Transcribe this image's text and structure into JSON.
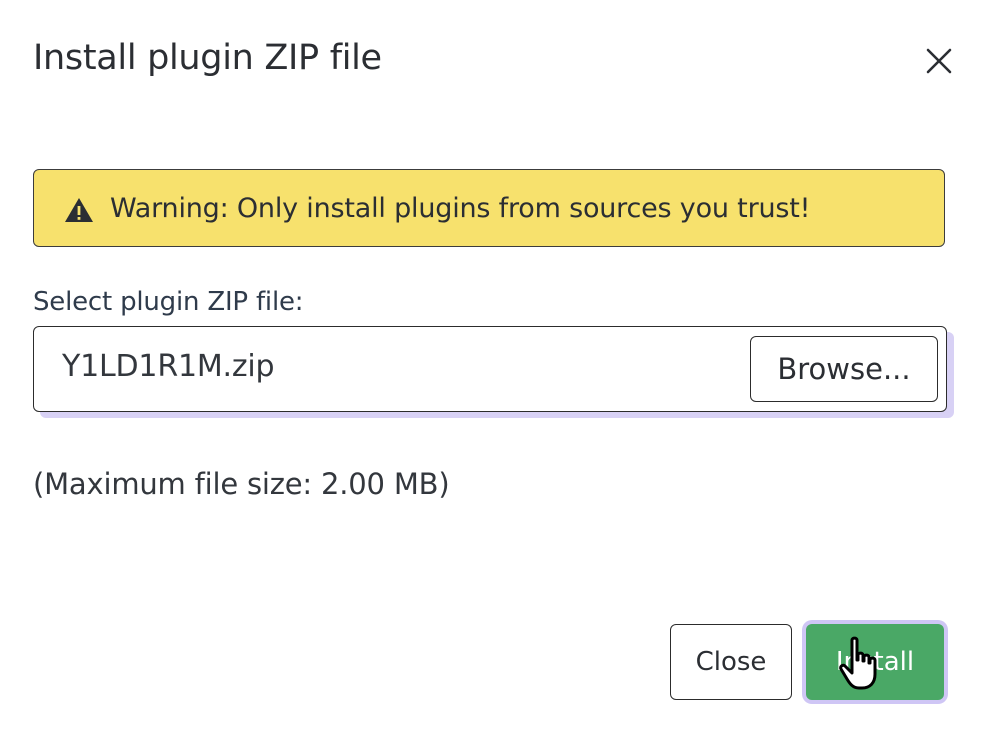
{
  "dialog": {
    "title": "Install plugin ZIP file",
    "close_icon": "close-icon"
  },
  "warning": {
    "icon": "warning-triangle-icon",
    "text": "Warning: Only install plugins from sources you trust!",
    "background_color": "#f7e16d"
  },
  "file_select": {
    "label": "Select plugin ZIP file:",
    "value": "Y1LD1R1M.zip",
    "browse_label": "Browse..."
  },
  "size_note": "(Maximum file size: 2.00 MB)",
  "footer": {
    "close_label": "Close",
    "install_label": "Install",
    "install_color": "#4aa866"
  }
}
